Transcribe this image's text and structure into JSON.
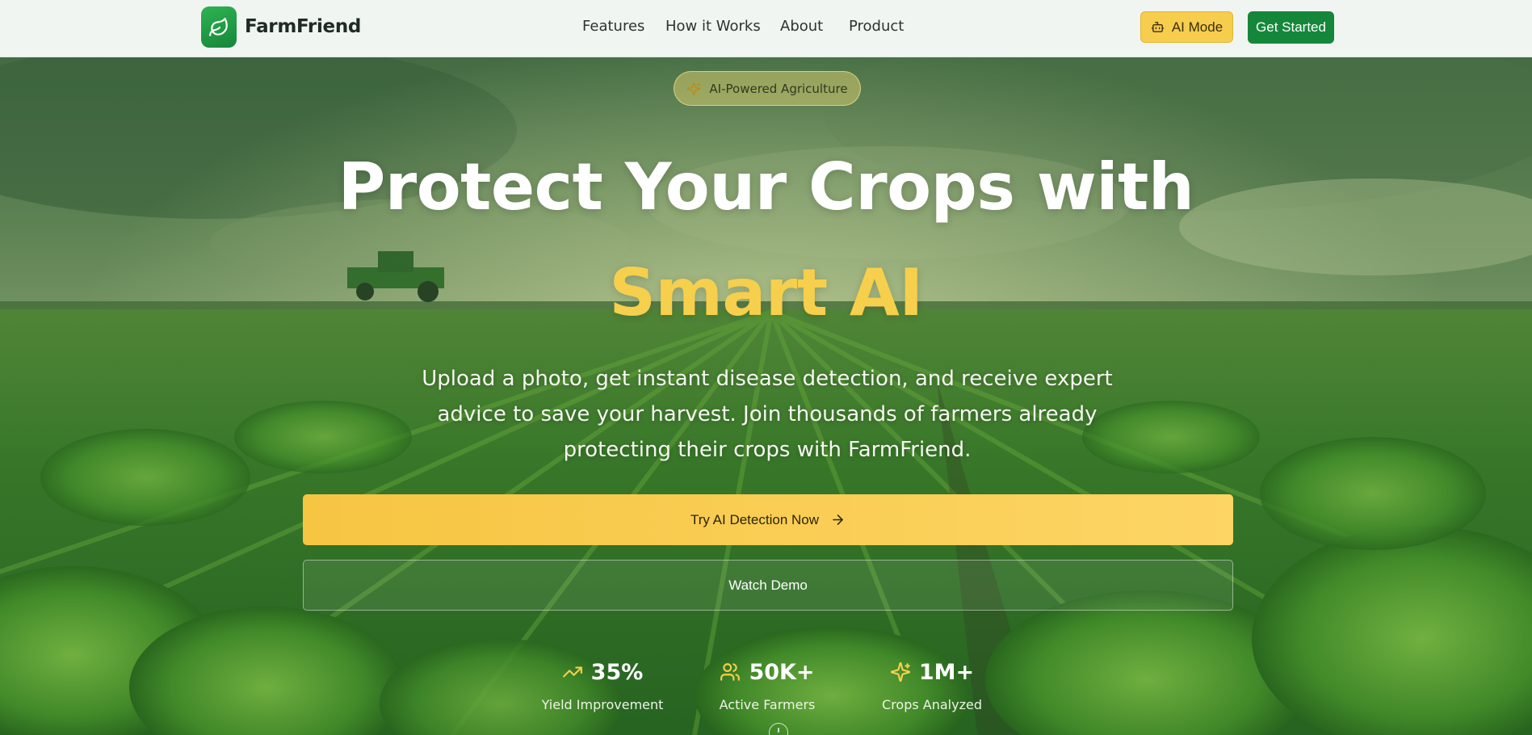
{
  "header": {
    "brand": "FarmFriend",
    "nav": [
      "Features",
      "How it Works",
      "About",
      "Product"
    ],
    "ai_mode_label": "AI Mode",
    "get_started_label": "Get Started"
  },
  "hero": {
    "badge": "AI-Powered Agriculture",
    "headline_line1": "Protect Your Crops with",
    "headline_line2": "Smart AI",
    "subtext": "Upload a photo, get instant disease detection, and receive expert advice to save your harvest. Join thousands of farmers already protecting their crops with FarmFriend.",
    "primary_cta": "Try AI Detection Now",
    "secondary_cta": "Watch Demo",
    "stats": [
      {
        "value": "35%",
        "label": "Yield Improvement",
        "icon": "trending-up-icon"
      },
      {
        "value": "50K+",
        "label": "Active Farmers",
        "icon": "users-icon"
      },
      {
        "value": "1M+",
        "label": "Crops Analyzed",
        "icon": "sparkles-icon"
      }
    ]
  },
  "colors": {
    "brand_green": "#15873a",
    "accent_yellow": "#f6cf4c",
    "header_bg": "#f1f5f1"
  }
}
